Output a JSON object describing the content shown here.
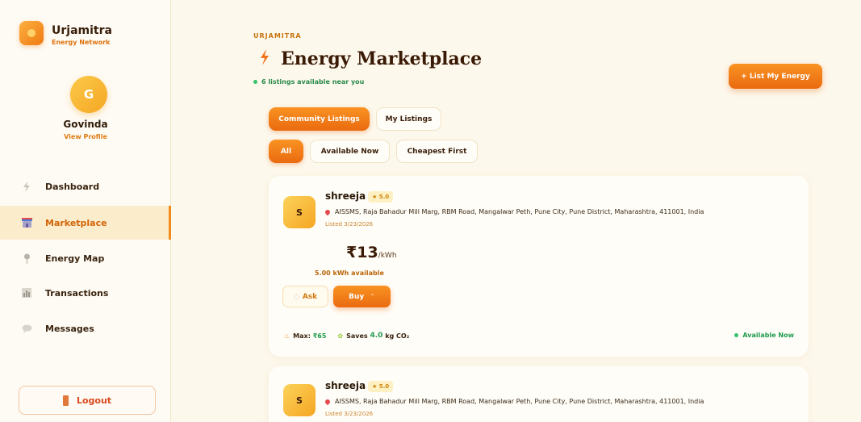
{
  "brand": {
    "name": "Urjamitra",
    "tagline": "Energy Network"
  },
  "profile": {
    "initial": "G",
    "name": "Govinda",
    "link": "View Profile"
  },
  "nav": [
    {
      "label": "Dashboard",
      "icon": "lightning-icon"
    },
    {
      "label": "Marketplace",
      "icon": "store-icon",
      "active": true
    },
    {
      "label": "Energy Map",
      "icon": "map-pin-icon"
    },
    {
      "label": "Transactions",
      "icon": "bar-chart-icon"
    },
    {
      "label": "Messages",
      "icon": "chat-icon"
    }
  ],
  "logout": "Logout",
  "header": {
    "eyebrow": "URJAMITRA",
    "title": "Energy Marketplace",
    "subtitle": "6 listings available near you",
    "list_button": "+ List My Energy"
  },
  "tabs": {
    "community": "Community Listings",
    "mine": "My Listings"
  },
  "filters": {
    "all": "All",
    "available": "Available Now",
    "cheapest": "Cheapest First"
  },
  "listings": [
    {
      "initial": "S",
      "seller": "shreeja",
      "rating": "★ 5.0",
      "address": "AISSMS, Raja Bahadur Mill Marg, RBM Road, Mangalwar Peth, Pune City, Pune District, Maharashtra, 411001, India",
      "listed": "Listed 3/23/2026",
      "price": "₹13",
      "unit": "/kWh",
      "available": "5.00 kWh available",
      "ask": "Ask",
      "buy": "Buy",
      "max_label": "Max:",
      "max_value": "₹65",
      "saves_label": "Saves",
      "saves_value": "4.0",
      "saves_unit": "kg CO₂",
      "status": "Available Now"
    },
    {
      "initial": "S",
      "seller": "shreeja",
      "rating": "★ 5.0",
      "address": "AISSMS, Raja Bahadur Mill Marg, RBM Road, Mangalwar Peth, Pune City, Pune District, Maharashtra, 411001, India",
      "listed": "Listed 3/23/2026"
    }
  ],
  "colors": {
    "accent": "#F08C1E",
    "success": "#1F9A4C",
    "background": "#FDF8EC"
  }
}
